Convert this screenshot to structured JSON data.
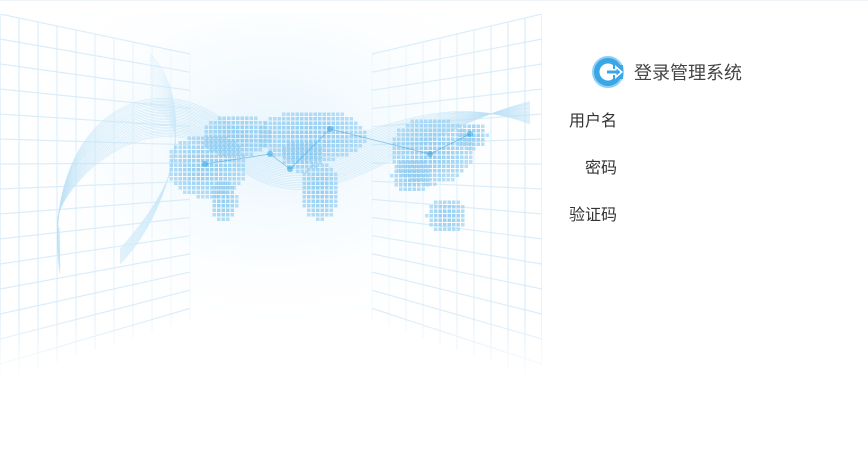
{
  "login": {
    "title": "登录管理系统",
    "logo_icon": "exit-arrow-icon",
    "fields": {
      "username": {
        "label": "用户名",
        "value": ""
      },
      "password": {
        "label": "密码",
        "value": ""
      },
      "captcha": {
        "label": "验证码",
        "value": ""
      }
    }
  },
  "colors": {
    "accent_blue": "#3aa6e6",
    "grid_line": "#d6ebf8",
    "title_text": "#444444",
    "label_text": "#333333"
  }
}
